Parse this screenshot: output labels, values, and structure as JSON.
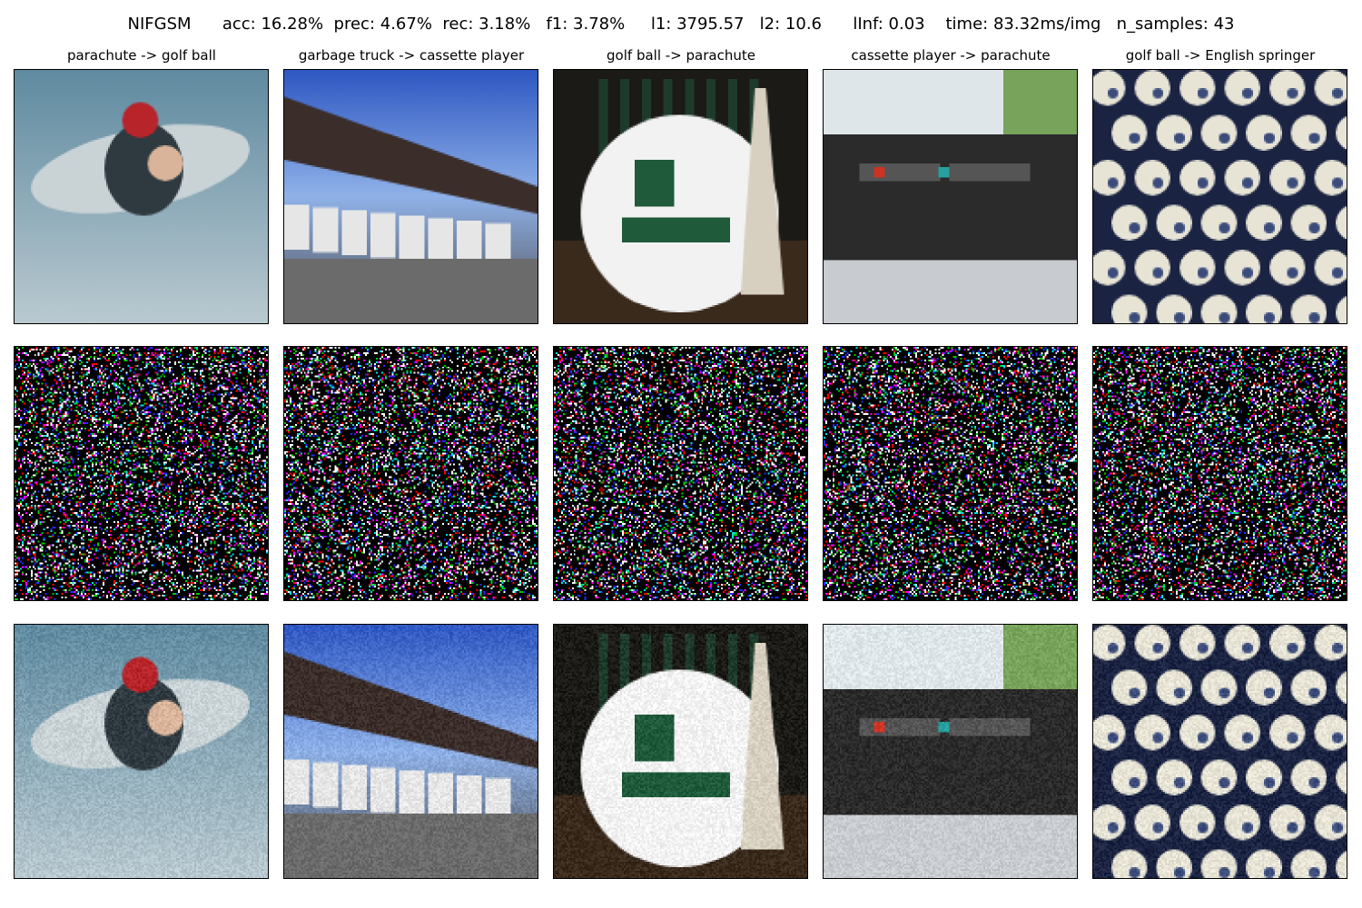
{
  "figure": {
    "suptitle": "NIFGSM      acc: 16.28%  prec: 4.67%  rec: 3.18%   f1: 3.78%     l1: 3795.57   l2: 10.6      lInf: 0.03    time: 83.32ms/img   n_samples: 43"
  },
  "columns": [
    {
      "title": "parachute -> golf ball",
      "scene": "skydivers",
      "colors": [
        "#7fa3b4",
        "#c9d3d6",
        "#2f3a40",
        "#b7242a"
      ]
    },
    {
      "title": "garbage truck -> cassette player",
      "scene": "trucks",
      "colors": [
        "#3a66c8",
        "#e6e6e6",
        "#3b2e2a",
        "#6b6b6b"
      ]
    },
    {
      "title": "golf ball -> parachute",
      "scene": "golfball",
      "colors": [
        "#1b1a16",
        "#f2f2f2",
        "#1f5a3a",
        "#d7cfc0"
      ]
    },
    {
      "title": "cassette player -> parachute",
      "scene": "boombox",
      "colors": [
        "#dfe3e6",
        "#2b2b2b",
        "#c9c9c9",
        "#77a35a"
      ]
    },
    {
      "title": "golf ball -> English springer",
      "scene": "pattern",
      "colors": [
        "#1a2341",
        "#e7e4d6",
        "#3b4b7a",
        "#c7c1ae"
      ]
    }
  ],
  "rows": [
    "original",
    "perturbation",
    "adversarial"
  ]
}
